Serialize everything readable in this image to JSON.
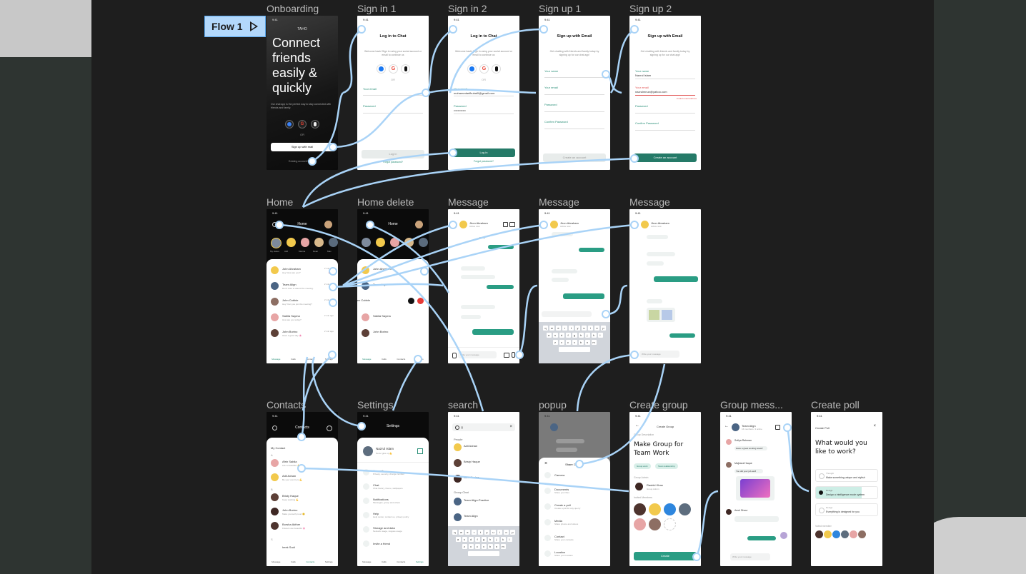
{
  "flow": {
    "label": "Flow 1"
  },
  "frames": [
    {
      "id": "onboarding",
      "label": "Onboarding"
    },
    {
      "id": "signin1",
      "label": "Sign in 1"
    },
    {
      "id": "signin2",
      "label": "Sign in 2"
    },
    {
      "id": "signup1",
      "label": "Sign up 1"
    },
    {
      "id": "signup2",
      "label": "Sign up 2"
    },
    {
      "id": "home",
      "label": "Home"
    },
    {
      "id": "homedelete",
      "label": "Home delete"
    },
    {
      "id": "message1",
      "label": "Message"
    },
    {
      "id": "message2",
      "label": "Message"
    },
    {
      "id": "message3",
      "label": "Message"
    },
    {
      "id": "contacts",
      "label": "Contacts"
    },
    {
      "id": "settings",
      "label": "Settings"
    },
    {
      "id": "search",
      "label": "search"
    },
    {
      "id": "popup",
      "label": "popup"
    },
    {
      "id": "creategroup",
      "label": "Create group"
    },
    {
      "id": "groupmsg",
      "label": "Group mess..."
    },
    {
      "id": "createpoll",
      "label": "Create poll"
    }
  ],
  "onboarding": {
    "time": "9:41",
    "brand": "TAHO",
    "headline": "Connect friends easily & quickly",
    "body": "Our chat app is the perfect way to stay connected with friends and family.",
    "or": "OR",
    "signup": "Sign up with mail",
    "login": "Existing account? Log in"
  },
  "signin1": {
    "time": "9:41",
    "title": "Log in to Chat",
    "subtitle": "Welcome back! Sign in using your social account or email to continue us",
    "or": "OR",
    "email_label": "Your email",
    "password_label": "Password",
    "button": "Log in",
    "forgot": "Forgot password?"
  },
  "signin2": {
    "time": "9:41",
    "title": "Log in to Chat",
    "subtitle": "Welcome back! Sign in using your social account or email to continue us",
    "or": "OR",
    "email_label": "Your email",
    "email_value": "mohamedarifkubal0@gmail.com",
    "password_label": "Password",
    "password_value": "••••••••••••",
    "button": "Log in",
    "forgot": "Forgot password?"
  },
  "signup1": {
    "time": "9:41",
    "title": "Sign up with Email",
    "subtitle": "Get chatting with friends and family today by signing up for our chat app!",
    "name_label": "Your name",
    "email_label": "Your email",
    "password_label": "Password",
    "confirm_label": "Confirm Password",
    "button": "Create an account"
  },
  "signup2": {
    "time": "9:41",
    "title": "Sign up with Email",
    "subtitle": "Get chatting with friends and family today by signing up for our chat app!",
    "name_label": "Your name",
    "name_value": "Nazrul Islam",
    "email_label": "Your email",
    "email_value": "nazrulmnun@yahoo.com",
    "email_error": "Invalid email address",
    "password_label": "Password",
    "confirm_label": "Confirm Password",
    "button": "Create an account"
  },
  "home": {
    "time": "9:41",
    "title": "Home",
    "stories": [
      "My status",
      "Adil",
      "Marina",
      "Dean",
      "Max"
    ],
    "chats": [
      {
        "name": "John Ahraham",
        "msg": "Hey! How are you?",
        "time": "2 min ago"
      },
      {
        "name": "Team Align",
        "msg": "Don't miss to attend the meeting.",
        "time": "2 min ago"
      },
      {
        "name": "John Cobble",
        "msg": "Hey! Can you join the meeting?",
        "time": "2 min ago"
      },
      {
        "name": "Sabila Sayma",
        "msg": "How are you today?",
        "time": "2 min ago"
      },
      {
        "name": "John Borino",
        "msg": "Have a good day 🌸",
        "time": "2 min ago"
      }
    ],
    "tabs": [
      "Message",
      "Calls",
      "Contacts",
      "Settings"
    ]
  },
  "homedelete": {
    "time": "9:41",
    "title": "Home",
    "swiped": "ex Cobble"
  },
  "message": {
    "time": "9:41",
    "contact": "Jhon Abraham",
    "status": "Active now",
    "today": "Today",
    "input_placeholder": "Write your message"
  },
  "contacts": {
    "time": "9:41",
    "title": "Contacts",
    "section": "My Contact",
    "people": [
      {
        "name": "Afrin Sabila",
        "status": "Life is beautiful 👌"
      },
      {
        "name": "Adil Adnan",
        "status": "Be your own hero 💪"
      },
      {
        "name": "Bristy Haque",
        "status": "Keep working 💪"
      },
      {
        "name": "John Borino",
        "status": "Make yourself proud 😊"
      },
      {
        "name": "Borsha Akther",
        "status": "Flowers are beautiful 🌸"
      },
      {
        "name": "heek Sodi",
        "status": ""
      }
    ],
    "letters": [
      "A",
      "B",
      "S"
    ]
  },
  "settings": {
    "time": "9:41",
    "title": "Settings",
    "user": "Nazrul Islam",
    "user_status": "Never give up 💪",
    "items": [
      {
        "title": "Account",
        "sub": "Privacy, security, change number"
      },
      {
        "title": "Chat",
        "sub": "Chat history, theme, wallpapers"
      },
      {
        "title": "Notifications",
        "sub": "Messages, group and others"
      },
      {
        "title": "Help",
        "sub": "Help center, contact us, privacy policy"
      },
      {
        "title": "Storage and data",
        "sub": "Network usage, stogare usage"
      },
      {
        "title": "Invite a friend",
        "sub": ""
      }
    ]
  },
  "search": {
    "time": "9:41",
    "query": "Q",
    "people_label": "People",
    "people": [
      "Adil Adnan",
      "Bristy Haque",
      "John Borino"
    ],
    "group_label": "Group Chat",
    "groups": [
      "Team Align-Practice",
      "Team Align"
    ]
  },
  "popup": {
    "time": "9:41",
    "title": "Share Content",
    "items": [
      {
        "title": "Camera",
        "sub": ""
      },
      {
        "title": "Documents",
        "sub": "Share your files"
      },
      {
        "title": "Create a poll",
        "sub": "Create a poll for any querry"
      },
      {
        "title": "Media",
        "sub": "Share photos and videos"
      },
      {
        "title": "Contact",
        "sub": "Share your contacts"
      },
      {
        "title": "Location",
        "sub": "Share your location"
      }
    ]
  },
  "creategroup": {
    "time": "9:41",
    "title": "Create Group",
    "desc_label": "Group Description",
    "desc": "Make Group  for Team Work",
    "chips": [
      "Group work",
      "Team relationship"
    ],
    "admin_label": "Group Admin",
    "admin": "Rashid Khan",
    "admin_role": "Group Admin",
    "members_label": "Invited Members",
    "button": "Create"
  },
  "groupmsg": {
    "time": "9:41",
    "title": "Team Align",
    "sub": "16 members, 3 online",
    "sender1": "Sofiya Rahman",
    "msg1": "Have a great working week!!",
    "sender2": "Majharul Haque",
    "msg2": "You did your job well!",
    "sender3": "Amel Dhour",
    "input_placeholder": "Write your message"
  },
  "createpoll": {
    "time": "9:41",
    "title": "Create Poll",
    "question": "What would you like to work?",
    "options": [
      {
        "title": "Thought",
        "sub": "Make something unique and stylish"
      },
      {
        "title": "Design",
        "sub": "Design a intelligence mode system"
      },
      {
        "title": "Design",
        "sub": "Everything is designed for you"
      }
    ],
    "voted_label": "Voted member"
  }
}
